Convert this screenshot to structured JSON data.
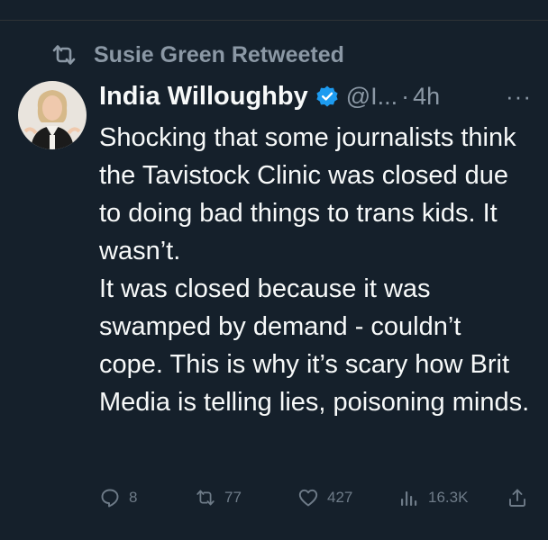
{
  "retweet": {
    "label": "Susie Green Retweeted",
    "icon": "retweet-icon"
  },
  "tweet": {
    "author_name": "India Willoughby",
    "handle": "@I...",
    "separator": "·",
    "time": "4h",
    "more": "···",
    "paragraphs": [
      "Shocking that some journalists think the Tavistock Clinic was closed due to doing bad things to trans kids. It wasn’t.",
      "It was closed because it was swamped by demand - couldn’t cope. This is why it’s scary how Brit Media is telling lies, poisoning minds."
    ]
  },
  "actions": {
    "replies": "8",
    "retweets": "77",
    "likes": "427",
    "views": "16.3K"
  },
  "colors": {
    "background": "#15202b",
    "text": "#f7f9f9",
    "muted": "#8b98a5",
    "verified": "#1d9bf0"
  }
}
